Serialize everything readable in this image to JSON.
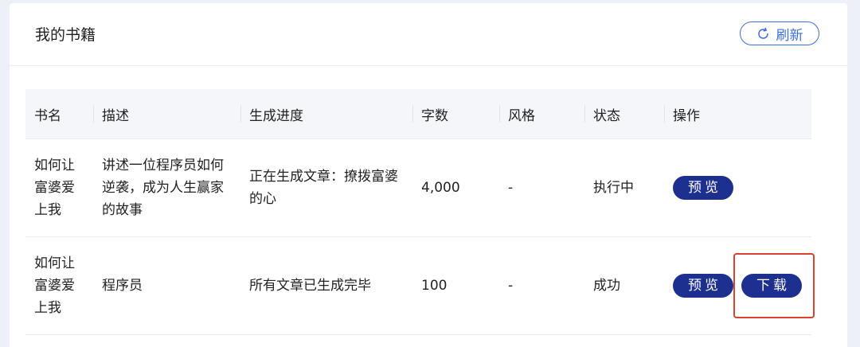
{
  "header": {
    "title": "我的书籍",
    "refresh_label": "刷新",
    "refresh_icon": "refresh-icon"
  },
  "table": {
    "columns": [
      "书名",
      "描述",
      "生成进度",
      "字数",
      "风格",
      "状态",
      "操作"
    ],
    "rows": [
      {
        "name": "如何让富婆爱上我",
        "description": "讲述一位程序员如何逆袭，成为人生赢家的故事",
        "progress": "正在生成文章：撩拨富婆的心",
        "word_count": "4,000",
        "style": "-",
        "status": "执行中",
        "actions": [
          "预览"
        ]
      },
      {
        "name": "如何让富婆爱上我",
        "description": "程序员",
        "progress": "所有文章已生成完毕",
        "word_count": "100",
        "style": "-",
        "status": "成功",
        "actions": [
          "预览",
          "下载"
        ]
      }
    ]
  },
  "colors": {
    "accent": "#3d6ee0",
    "button_bg": "#1d2f8f",
    "highlight": "#d9432e",
    "header_bg": "#f4f6fa"
  }
}
